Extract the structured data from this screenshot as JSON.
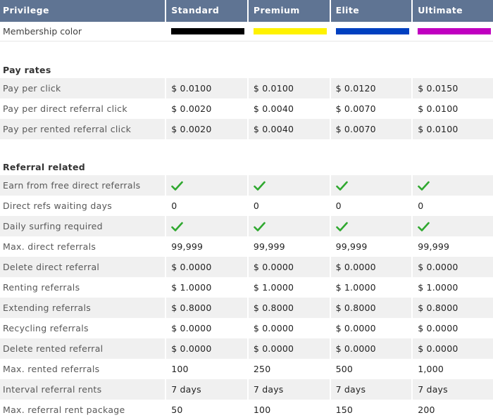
{
  "header": {
    "privilege": "Privilege",
    "standard": "Standard",
    "premium": "Premium",
    "elite": "Elite",
    "ultimate": "Ultimate"
  },
  "membership": {
    "label": "Membership color",
    "colors": [
      "#000000",
      "#fff200",
      "#0040c0",
      "#c000c0"
    ]
  },
  "pay_rates": {
    "title": "Pay rates",
    "rows": [
      {
        "label": "Pay per click",
        "values": [
          "$ 0.0100",
          "$ 0.0100",
          "$ 0.0120",
          "$ 0.0150"
        ]
      },
      {
        "label": "Pay per direct referral click",
        "values": [
          "$ 0.0020",
          "$ 0.0040",
          "$ 0.0070",
          "$ 0.0100"
        ]
      },
      {
        "label": "Pay per rented referral click",
        "values": [
          "$ 0.0020",
          "$ 0.0040",
          "$ 0.0070",
          "$ 0.0100"
        ]
      }
    ]
  },
  "referral": {
    "title": "Referral related",
    "check_icon": "check-icon",
    "check_color": "#2fa82f",
    "rows": [
      {
        "label": "Earn from free direct referrals",
        "check": true
      },
      {
        "label": "Direct refs waiting days",
        "values": [
          "0",
          "0",
          "0",
          "0"
        ]
      },
      {
        "label": "Daily surfing required",
        "check": true
      },
      {
        "label": "Max. direct referrals",
        "values": [
          "99,999",
          "99,999",
          "99,999",
          "99,999"
        ]
      },
      {
        "label": "Delete direct referral",
        "values": [
          "$ 0.0000",
          "$ 0.0000",
          "$ 0.0000",
          "$ 0.0000"
        ]
      },
      {
        "label": "Renting referrals",
        "values": [
          "$ 1.0000",
          "$ 1.0000",
          "$ 1.0000",
          "$ 1.0000"
        ]
      },
      {
        "label": "Extending referrals",
        "values": [
          "$ 0.8000",
          "$ 0.8000",
          "$ 0.8000",
          "$ 0.8000"
        ]
      },
      {
        "label": "Recycling referrals",
        "values": [
          "$ 0.0000",
          "$ 0.0000",
          "$ 0.0000",
          "$ 0.0000"
        ]
      },
      {
        "label": "Delete rented referral",
        "values": [
          "$ 0.0000",
          "$ 0.0000",
          "$ 0.0000",
          "$ 0.0000"
        ]
      },
      {
        "label": "Max. rented referrals",
        "values": [
          "100",
          "250",
          "500",
          "1,000"
        ]
      },
      {
        "label": "Interval referral rents",
        "values": [
          "7 days",
          "7 days",
          "7 days",
          "7 days"
        ]
      },
      {
        "label": "Max. referral rent package",
        "values": [
          "50",
          "100",
          "150",
          "200"
        ]
      }
    ]
  }
}
